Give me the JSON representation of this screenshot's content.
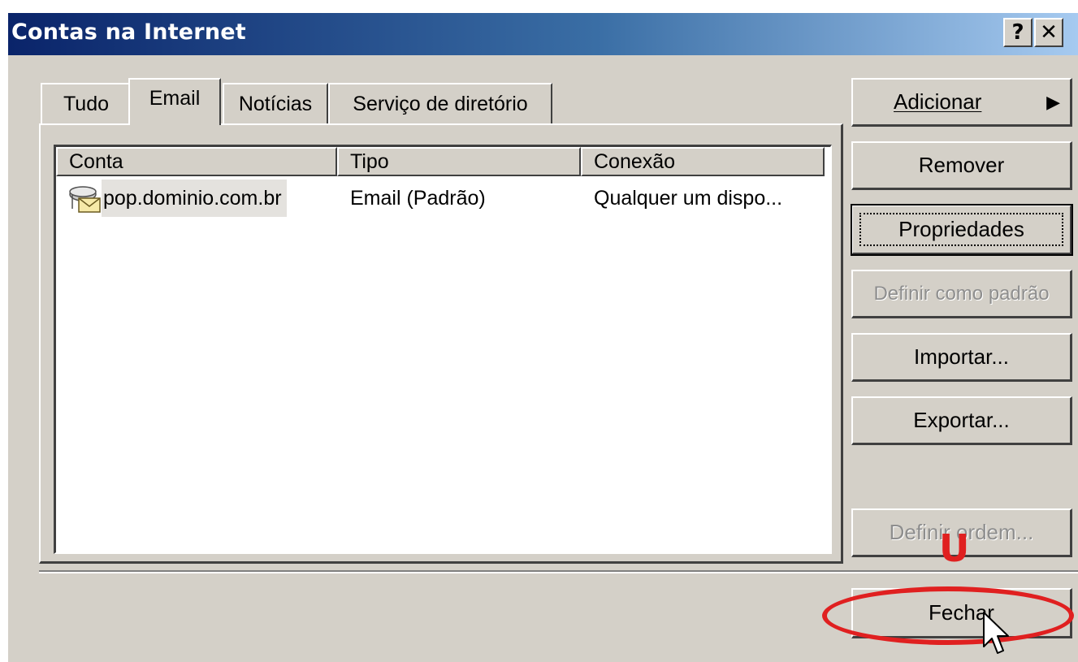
{
  "window": {
    "title": "Contas na Internet",
    "help_button": "?",
    "close_button": "✕"
  },
  "tabs": [
    {
      "label": "Tudo",
      "active": false
    },
    {
      "label": "Email",
      "active": true
    },
    {
      "label": "Notícias",
      "active": false
    },
    {
      "label": "Serviço de diretório",
      "active": false
    }
  ],
  "list": {
    "columns": [
      "Conta",
      "Tipo",
      "Conexão"
    ],
    "rows": [
      {
        "conta": "pop.dominio.com.br",
        "tipo": "Email (Padrão)",
        "conexao": "Qualquer um dispo...",
        "icon": "mail-account-icon"
      }
    ]
  },
  "buttons": {
    "adicionar": {
      "label": "Adicionar",
      "arrow": "▶"
    },
    "remover": "Remover",
    "propriedades": "Propriedades",
    "definir_padrao": "Definir como padrão",
    "importar": "Importar...",
    "exportar": "Exportar...",
    "definir_ordem": "Definir ordem...",
    "fechar": "Fechar"
  },
  "annotation": {
    "mark": "U",
    "color": "#e02020"
  },
  "colors": {
    "face": "#d4d0c8",
    "title_start": "#0a246a",
    "title_end": "#a6caf0"
  }
}
